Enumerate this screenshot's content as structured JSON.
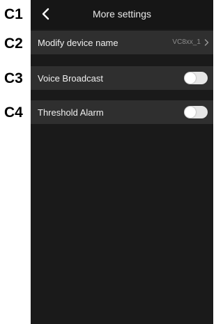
{
  "callouts": [
    "C1",
    "C2",
    "C3",
    "C4"
  ],
  "header": {
    "title": "More settings",
    "back_icon": "chevron-left-icon"
  },
  "settings": [
    {
      "label": "Modify device name",
      "value": "VC8xx_1",
      "type": "link",
      "icon": "chevron-right-icon"
    },
    {
      "label": "Voice Broadcast",
      "type": "toggle",
      "enabled": false
    },
    {
      "label": "Threshold Alarm",
      "type": "toggle",
      "enabled": false
    }
  ],
  "colors": {
    "screen_bg": "#1a1a1a",
    "header_bg": "#161616",
    "row_bg": "#2f2f2f",
    "text": "#f0f0f0",
    "value_text": "#8c8c8c",
    "toggle_off": "#e6e6e6"
  }
}
